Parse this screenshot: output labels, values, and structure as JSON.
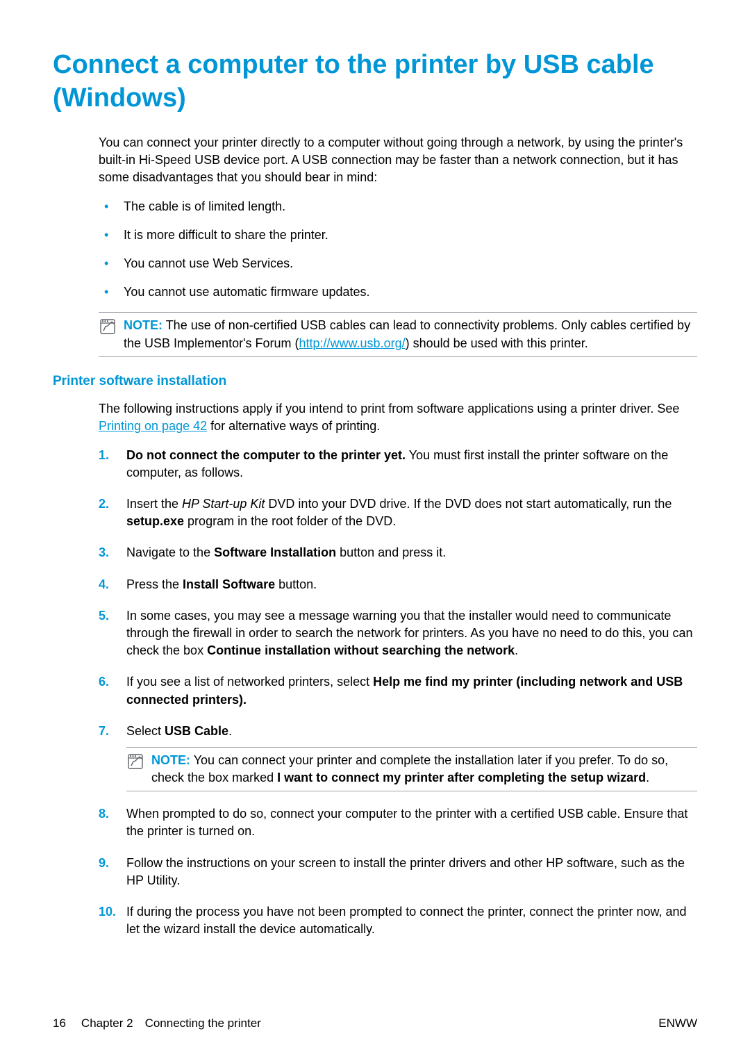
{
  "heading": "Connect a computer to the printer by USB cable (Windows)",
  "intro": "You can connect your printer directly to a computer without going through a network, by using the printer's built-in Hi-Speed USB device port. A USB connection may be faster than a network connection, but it has some disadvantages that you should bear in mind:",
  "bullets": [
    "The cable is of limited length.",
    "It is more difficult to share the printer.",
    "You cannot use Web Services.",
    "You cannot use automatic firmware updates."
  ],
  "note1": {
    "label": "NOTE:",
    "pre": "The use of non-certified USB cables can lead to connectivity problems. Only cables certified by the USB Implementor's Forum (",
    "link_text": "http://www.usb.org/",
    "post": ") should be used with this printer."
  },
  "subheading": "Printer software installation",
  "sub_intro_pre": "The following instructions apply if you intend to print from software applications using a printer driver. See ",
  "sub_intro_link": "Printing on page 42",
  "sub_intro_post": " for alternative ways of printing.",
  "steps": {
    "s1_bold": "Do not connect the computer to the printer yet.",
    "s1_rest": " You must first install the printer software on the computer, as follows.",
    "s2_pre": "Insert the ",
    "s2_italic": "HP Start-up Kit",
    "s2_mid": " DVD into your DVD drive. If the DVD does not start automatically, run the ",
    "s2_bold": "setup.exe",
    "s2_post": " program in the root folder of the DVD.",
    "s3_pre": "Navigate to the ",
    "s3_bold": "Software Installation",
    "s3_post": " button and press it.",
    "s4_pre": "Press the ",
    "s4_bold": "Install Software",
    "s4_post": " button.",
    "s5_pre": "In some cases, you may see a message warning you that the installer would need to communicate through the firewall in order to search the network for printers. As you have no need to do this, you can check the box ",
    "s5_bold": "Continue installation without searching the network",
    "s5_post": ".",
    "s6_pre": "If you see a list of networked printers, select ",
    "s6_bold": "Help me find my printer (including network and USB connected printers).",
    "s7_pre": "Select ",
    "s7_bold": "USB Cable",
    "s7_post": ".",
    "s7_note_label": "NOTE:",
    "s7_note_pre": "You can connect your printer and complete the installation later if you prefer. To do so, check the box marked ",
    "s7_note_bold": "I want to connect my printer after completing the setup wizard",
    "s7_note_post": ".",
    "s8": "When prompted to do so, connect your computer to the printer with a certified USB cable. Ensure that the printer is turned on.",
    "s9": "Follow the instructions on your screen to install the printer drivers and other HP software, such as the HP Utility.",
    "s10": "If during the process you have not been prompted to connect the printer, connect the printer now, and let the wizard install the device automatically."
  },
  "footer": {
    "page": "16",
    "chapter": "Chapter 2 Connecting the printer",
    "right": "ENWW"
  }
}
